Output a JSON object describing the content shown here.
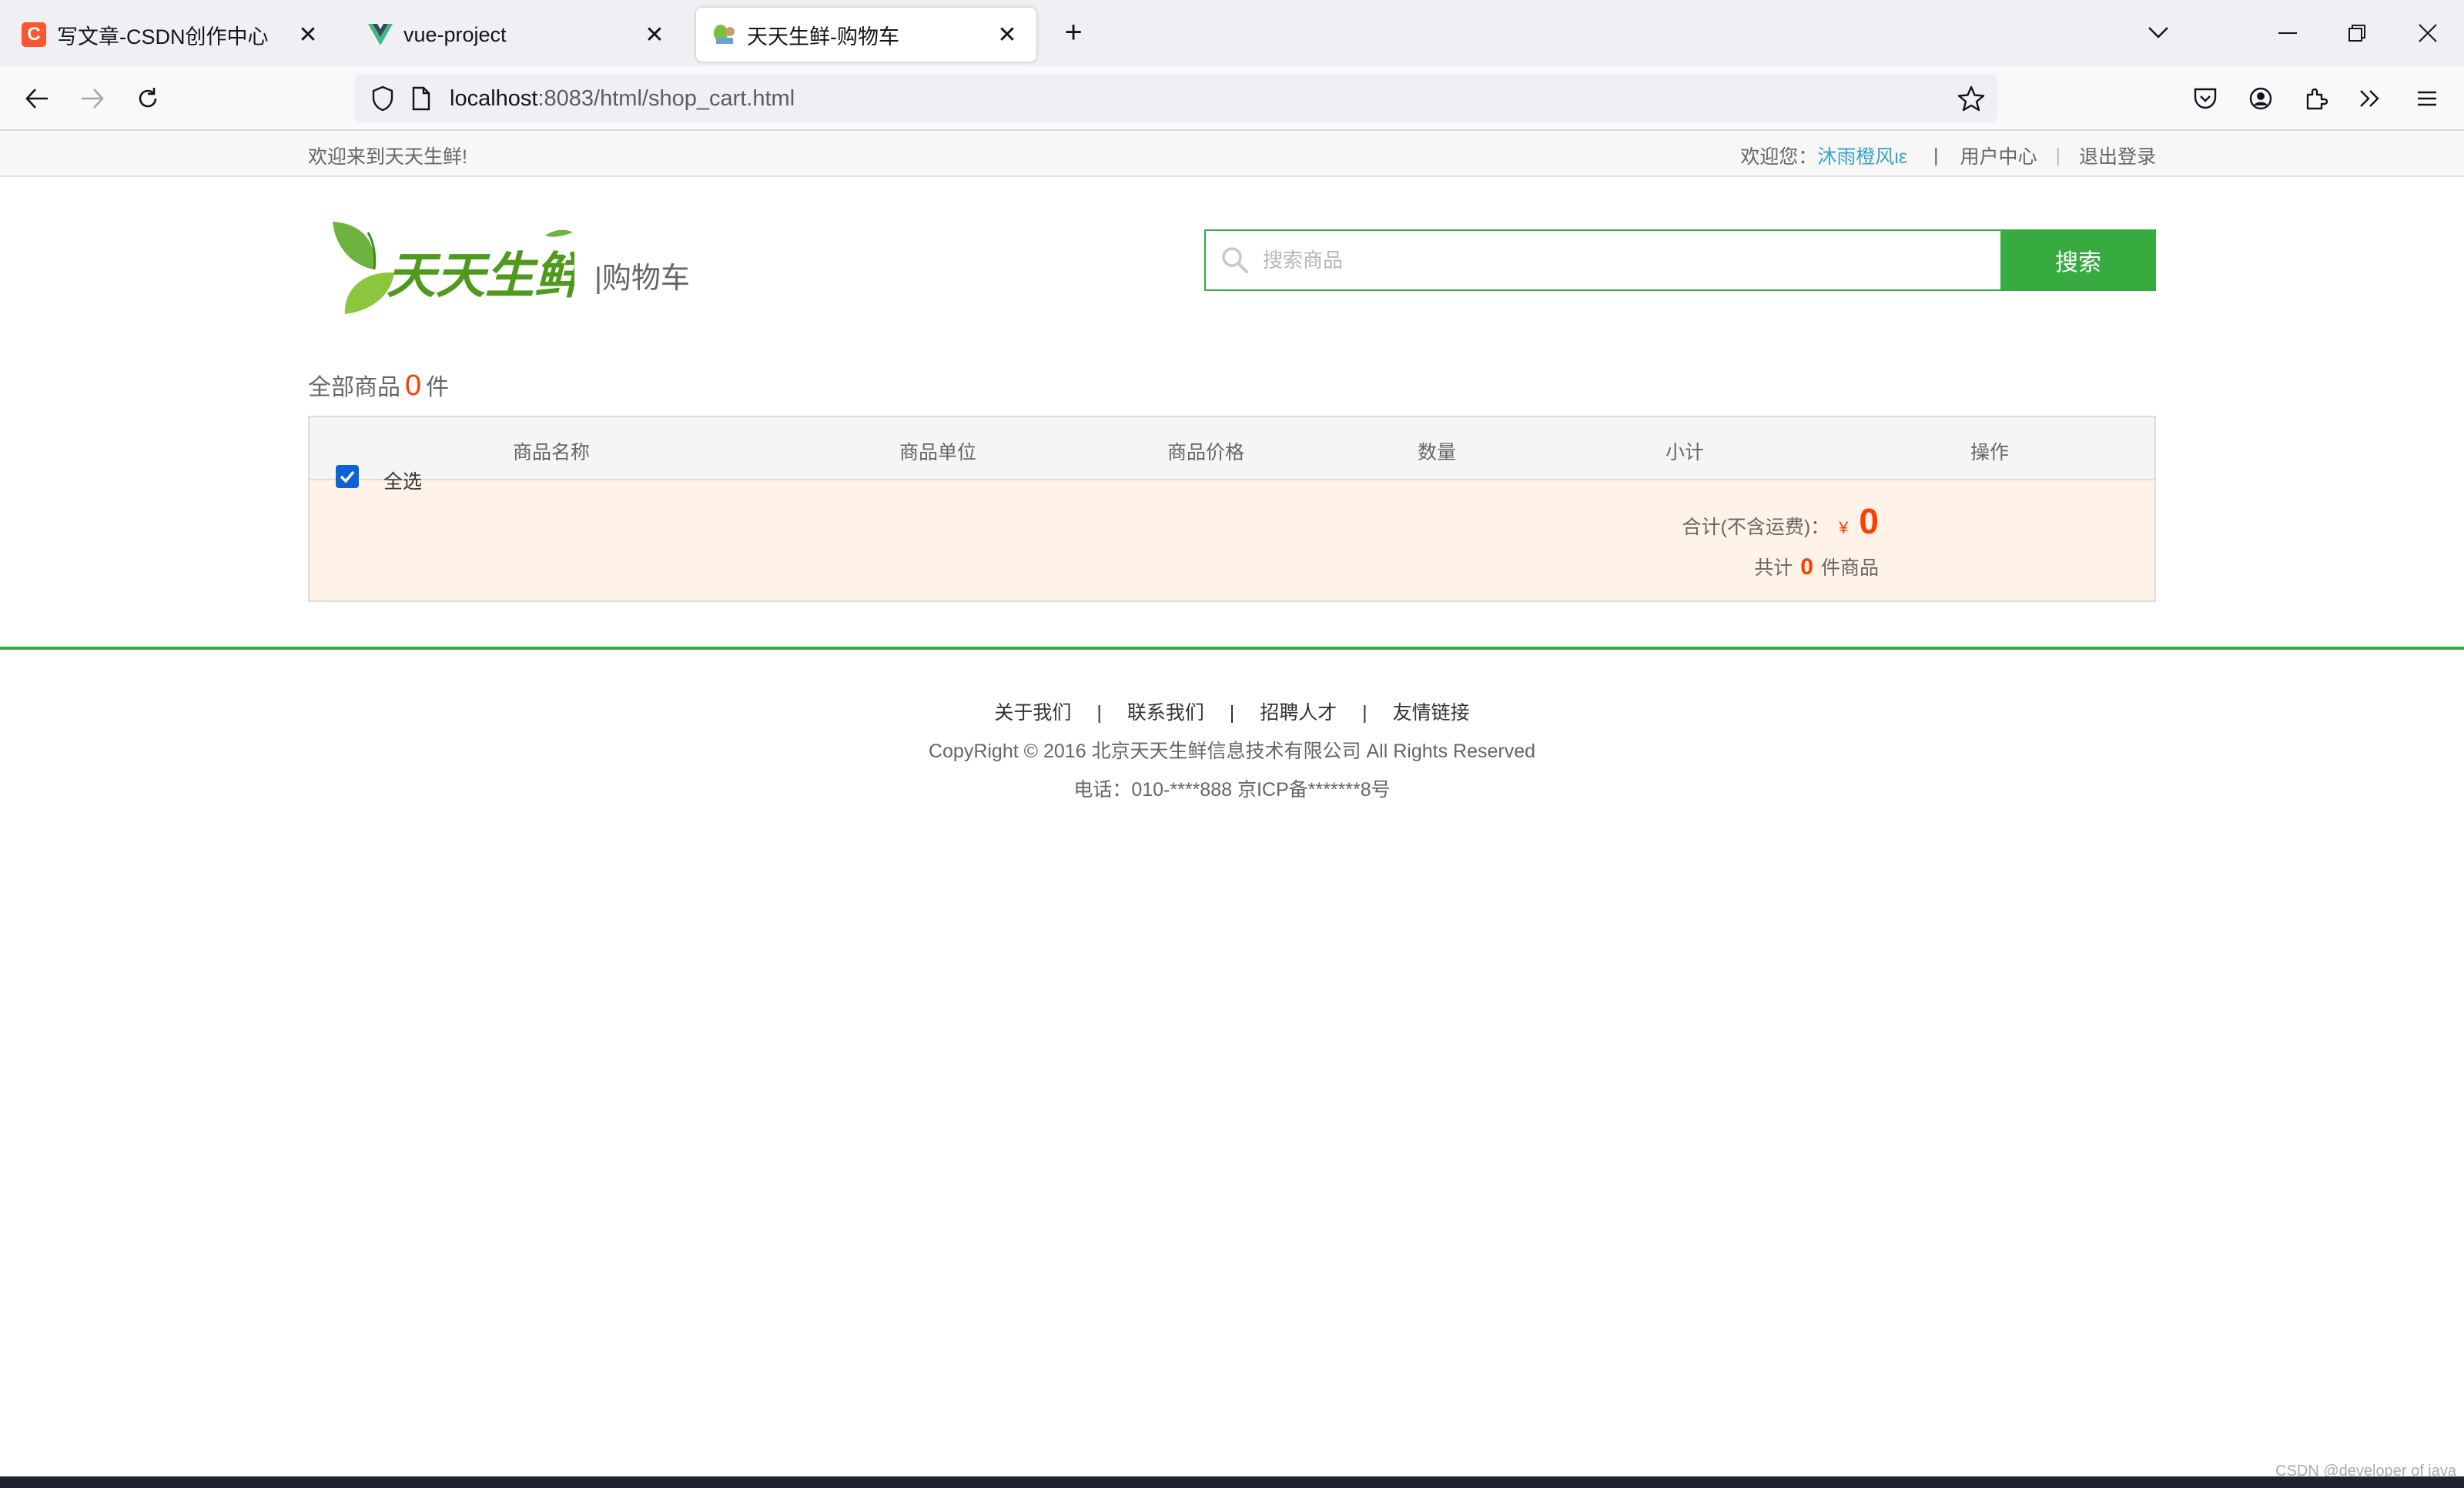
{
  "browser": {
    "tabs": [
      {
        "label": "写文章-CSDN创作中心",
        "icon": "csdn-icon",
        "active": false
      },
      {
        "label": "vue-project",
        "icon": "vue-icon",
        "active": false
      },
      {
        "label": "天天生鲜-购物车",
        "icon": "site-icon",
        "active": true
      }
    ],
    "url_host": "localhost",
    "url_rest": ":8083/html/shop_cart.html",
    "csdn_icon_letter": "C"
  },
  "site": {
    "welcome": "欢迎来到天天生鲜!",
    "greeting": "欢迎您：",
    "username": "沐雨橙风ιε",
    "sep": "|",
    "user_center": "用户中心",
    "logout": "退出登录",
    "page_title": "|购物车",
    "logo_text": "天天生鲜",
    "search_placeholder": "搜索商品",
    "search_button": "搜索",
    "accent": "#37ab40"
  },
  "cart": {
    "all_label": "全部商品",
    "total_count": "0",
    "unit": "件",
    "columns": [
      "商品名称",
      "商品单位",
      "商品价格",
      "数量",
      "小计",
      "操作"
    ],
    "select_all": "全选",
    "select_all_checked": true,
    "total_label": "合计(不含运费)：",
    "currency": "¥",
    "total_price": "0",
    "count_prefix": "共计",
    "count_value": "0",
    "count_suffix": "件商品"
  },
  "footer": {
    "links": [
      "关于我们",
      "联系我们",
      "招聘人才",
      "友情链接"
    ],
    "sep": "|",
    "copyright": "CopyRight © 2016 北京天天生鲜信息技术有限公司 All Rights Reserved",
    "phone": "电话：010-****888 京ICP备*******8号"
  },
  "watermark": "CSDN @developer of java"
}
